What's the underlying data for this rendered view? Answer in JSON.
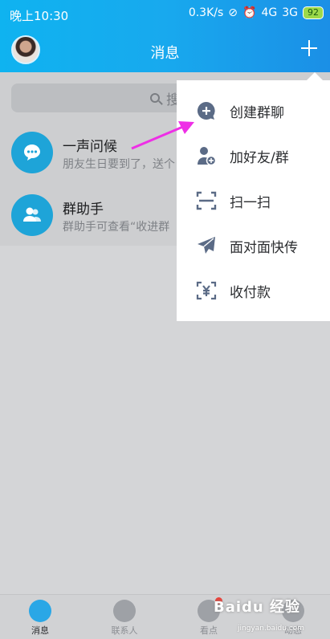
{
  "status_bar": {
    "time": "晚上10:30",
    "speed": "0.3K/s",
    "network1": "4G",
    "network2": "3G",
    "battery": "92"
  },
  "header": {
    "title": "消息"
  },
  "search": {
    "placeholder": "搜"
  },
  "chats": [
    {
      "name": "一声问候",
      "preview": "朋友生日要到了，送个"
    },
    {
      "name": "群助手",
      "preview": "群助手可查看“收进群"
    }
  ],
  "menu": {
    "items": [
      {
        "label": "创建群聊",
        "icon": "create-group-icon"
      },
      {
        "label": "加好友/群",
        "icon": "add-friend-icon"
      },
      {
        "label": "扫一扫",
        "icon": "scan-icon"
      },
      {
        "label": "面对面快传",
        "icon": "send-icon"
      },
      {
        "label": "收付款",
        "icon": "payment-icon"
      }
    ]
  },
  "bottom_nav": {
    "items": [
      {
        "label": "消息"
      },
      {
        "label": "联系人"
      },
      {
        "label": "看点"
      },
      {
        "label": "动态"
      }
    ]
  },
  "watermark": {
    "brand": "Baidu 经验",
    "url": "jingyan.baidu.com"
  },
  "colors": {
    "header_start": "#0fb3f0",
    "header_end": "#1b8fe6",
    "accent": "#1ea4d8",
    "arrow": "#ee2fe6"
  }
}
